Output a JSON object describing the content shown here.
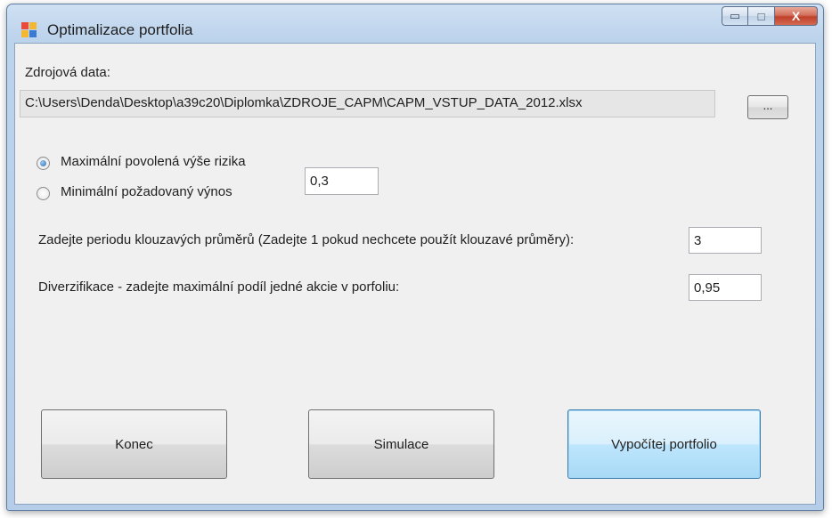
{
  "window": {
    "title": "Optimalizace portfolia",
    "controls": {
      "minimize_icon": "minimize-icon",
      "maximize_icon": "maximize-icon",
      "close_icon": "close-icon",
      "minimize_glyph": "▭",
      "maximize_glyph": "□",
      "close_glyph": "X"
    }
  },
  "source": {
    "label": "Zdrojová data:",
    "path": "C:\\Users\\Denda\\Desktop\\a39c20\\Diplomka\\ZDROJE_CAPM\\CAPM_VSTUP_DATA_2012.xlsx",
    "browse_label": "..."
  },
  "constraint": {
    "options": [
      {
        "label": "Maximální povolená výše rizika",
        "checked": true
      },
      {
        "label": "Minimální požadovaný výnos",
        "checked": false
      }
    ],
    "value": "0,3"
  },
  "moving_average": {
    "label": "Zadejte periodu klouzavých průměrů (Zadejte 1 pokud nechcete použít klouzavé průměry):",
    "value": "3"
  },
  "diversification": {
    "label": "Diverzifikace - zadejte maximální podíl jedné akcie v porfoliu:",
    "value": "0,95"
  },
  "buttons": {
    "exit": "Konec",
    "simulate": "Simulace",
    "compute": "Vypočítej portfolio"
  },
  "colors": {
    "accent": "#3c7fb1",
    "close_button": "#c0402a",
    "client_background": "#f0f0f0"
  }
}
